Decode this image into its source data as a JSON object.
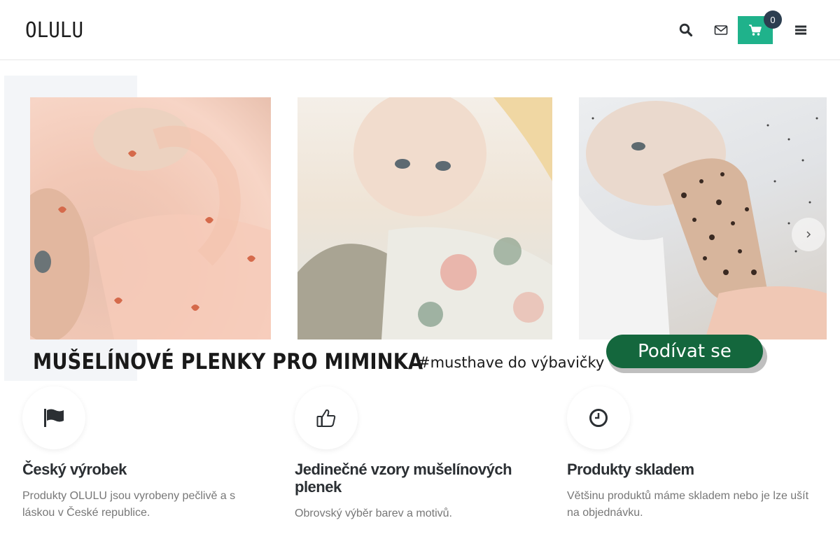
{
  "header": {
    "logo": "OLULU",
    "cart_count": "0",
    "icons": [
      "search-icon",
      "envelope-icon",
      "cart-icon",
      "hamburger-icon"
    ],
    "cart_color": "#1fb28b"
  },
  "banner": {
    "title": "MUŠELÍNOVÉ PLENKY PRO MIMINKA",
    "hashtag": "#musthave do výbavičky",
    "cta_label": "Podívat se",
    "cta_color": "#14673d"
  },
  "features": [
    {
      "icon": "flag-icon",
      "title": "Český výrobek",
      "description": "Produkty OLULU jsou vyrobeny pečlivě a s láskou v České republice."
    },
    {
      "icon": "thumbs-up-icon",
      "title": "Jedinečné vzory mušelínových plenek",
      "description": "Obrovský výběr barev a motivů."
    },
    {
      "icon": "clock-icon",
      "title": "Produkty skladem",
      "description": "Většinu produktů máme skladem nebo je lze ušít na objednávku."
    }
  ]
}
